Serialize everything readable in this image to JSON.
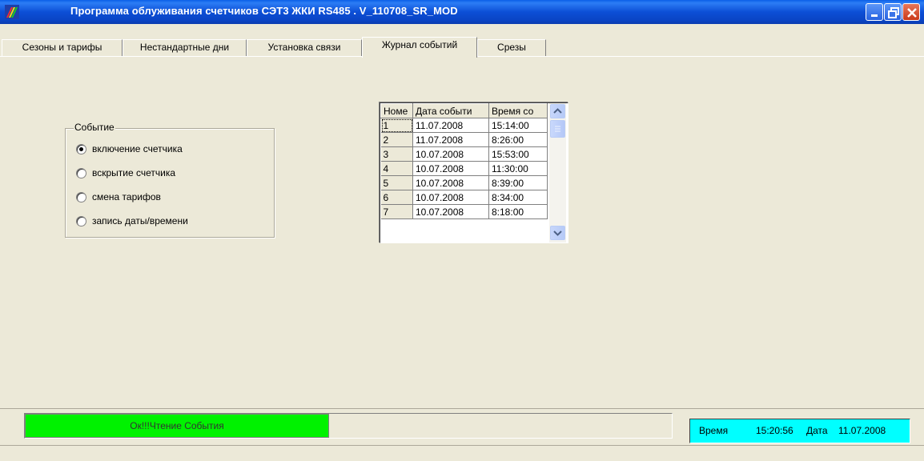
{
  "window": {
    "title": "Программа облуживания счетчиков СЭТ3   ЖКИ RS485 .  V_110708_SR_MOD",
    "controls": [
      "minimize-icon",
      "restore-icon",
      "close-icon"
    ]
  },
  "tabs": [
    {
      "label": "Сезоны и тарифы",
      "active": false
    },
    {
      "label": "Нестандартные дни",
      "active": false
    },
    {
      "label": "Установка связи",
      "active": false
    },
    {
      "label": "Журнал событий",
      "active": true
    },
    {
      "label": "Срезы",
      "active": false
    }
  ],
  "event_group": {
    "title": "Событие",
    "options": [
      {
        "label": "включение счетчика",
        "selected": true
      },
      {
        "label": "вскрытие счетчика",
        "selected": false
      },
      {
        "label": "смена тарифов",
        "selected": false
      },
      {
        "label": "запись даты/времени",
        "selected": false
      }
    ]
  },
  "grid": {
    "headers": [
      "Номе",
      "Дата событи",
      "Время со"
    ],
    "rows": [
      [
        "1",
        "11.07.2008",
        "15:14:00"
      ],
      [
        "2",
        "11.07.2008",
        "8:26:00"
      ],
      [
        "3",
        "10.07.2008",
        "15:53:00"
      ],
      [
        "4",
        "10.07.2008",
        "11:30:00"
      ],
      [
        "5",
        "10.07.2008",
        "8:39:00"
      ],
      [
        "6",
        "10.07.2008",
        "8:34:00"
      ],
      [
        "7",
        "10.07.2008",
        "8:18:00"
      ]
    ]
  },
  "status": {
    "message": "Ок!!!Чтение События",
    "progress_fraction": 0.47,
    "time_label": "Время",
    "time_value": "15:20:56",
    "date_label": "Дата",
    "date_value": "11.07.2008"
  },
  "colors": {
    "titlebar": "#0A44C4",
    "face": "#ECE9D8",
    "progress": "#00F200",
    "time_panel": "#00FFFF"
  }
}
